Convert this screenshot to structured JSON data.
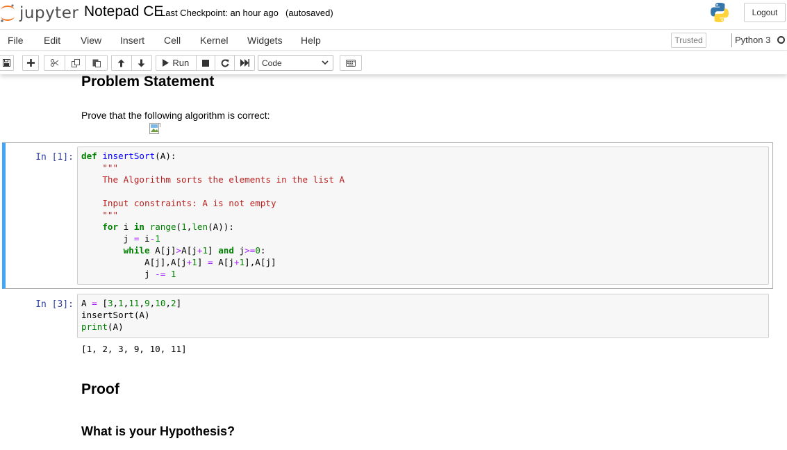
{
  "header": {
    "logo_text": "jupyter",
    "notebook_title": "Notepad CE",
    "checkpoint_text": "Last Checkpoint: an hour ago",
    "autosave_status": "(autosaved)",
    "logout_label": "Logout"
  },
  "menubar": {
    "items": [
      "File",
      "Edit",
      "View",
      "Insert",
      "Cell",
      "Kernel",
      "Widgets",
      "Help"
    ],
    "trusted_label": "Trusted",
    "kernel_name": "Python 3"
  },
  "toolbar": {
    "run_label": "Run",
    "cell_type": "Code",
    "icons": [
      "save-icon",
      "plus-icon",
      "cut-icon",
      "copy-icon",
      "paste-icon",
      "arrow-up-icon",
      "arrow-down-icon",
      "play-icon",
      "stop-icon",
      "restart-icon",
      "fast-forward-icon",
      "keyboard-icon"
    ]
  },
  "notebook": {
    "problem_heading": "Problem Statement",
    "problem_text": "Prove that the following algorithm is correct:",
    "cell1": {
      "prompt": "In [1]:",
      "code_lines": [
        "def insertSort(A):",
        "    \"\"\"",
        "    The Algorithm sorts the elements in the list A",
        "",
        "    Input constraints: A is not empty",
        "    \"\"\"",
        "    for i in range(1,len(A)):",
        "        j = i-1",
        "        while A[j]>A[j+1] and j>=0:",
        "            A[j],A[j+1] = A[j+1],A[j]",
        "            j -= 1"
      ]
    },
    "cell2": {
      "prompt": "In [3]:",
      "code_lines": [
        "A = [3,1,11,9,10,2]",
        "insertSort(A)",
        "print(A)"
      ],
      "output": "[1, 2, 3, 9, 10, 11]"
    },
    "proof_heading": "Proof",
    "hypothesis_heading": "What is your Hypothesis?"
  },
  "colors": {
    "selected_cell_border": "#42a5f5",
    "prompt_color": "#303f9f",
    "keyword": "#008000",
    "string": "#ba2121",
    "operator": "#aa22ff",
    "function_name": "#0000ff"
  }
}
